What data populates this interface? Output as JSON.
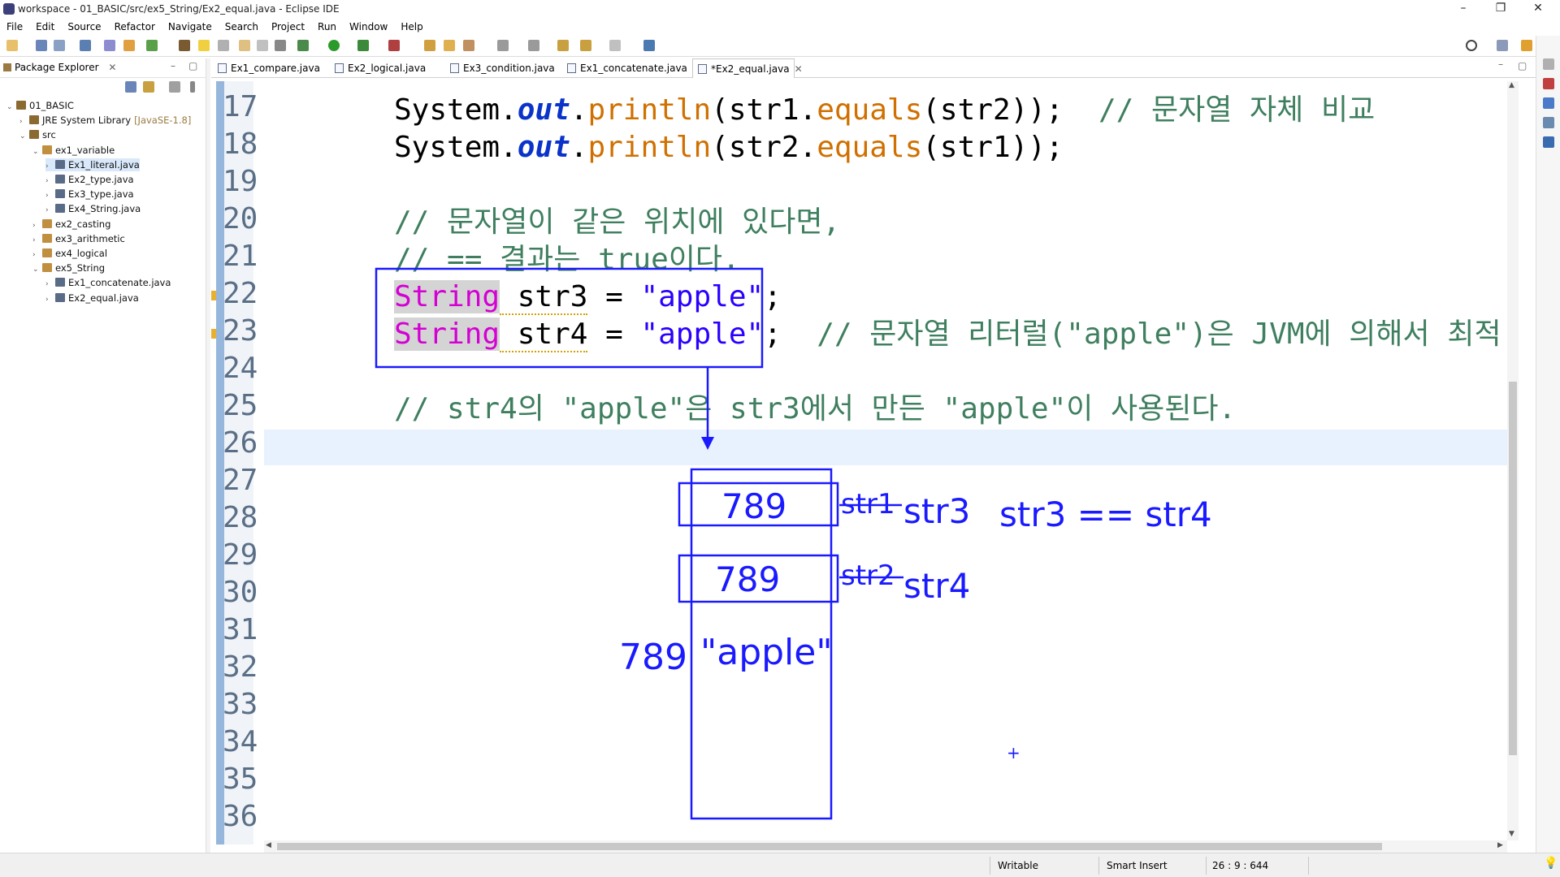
{
  "window": {
    "title": "workspace - 01_BASIC/src/ex5_String/Ex2_equal.java - Eclipse IDE"
  },
  "menu": [
    "File",
    "Edit",
    "Source",
    "Refactor",
    "Navigate",
    "Search",
    "Project",
    "Run",
    "Window",
    "Help"
  ],
  "package_explorer": {
    "tab_label": "Package Explorer",
    "tree": [
      {
        "label": "01_BASIC",
        "depth": 0,
        "expanded": true
      },
      {
        "label": "JRE System Library",
        "suffix": "[JavaSE-1.8]",
        "depth": 1,
        "expanded": false
      },
      {
        "label": "src",
        "depth": 1,
        "expanded": true
      },
      {
        "label": "ex1_variable",
        "depth": 2,
        "expanded": true
      },
      {
        "label": "Ex1_literal.java",
        "depth": 3,
        "selected": true
      },
      {
        "label": "Ex2_type.java",
        "depth": 3
      },
      {
        "label": "Ex3_type.java",
        "depth": 3
      },
      {
        "label": "Ex4_String.java",
        "depth": 3
      },
      {
        "label": "ex2_casting",
        "depth": 2
      },
      {
        "label": "ex3_arithmetic",
        "depth": 2
      },
      {
        "label": "ex4_logical",
        "depth": 2
      },
      {
        "label": "ex5_String",
        "depth": 2,
        "expanded": true
      },
      {
        "label": "Ex1_concatenate.java",
        "depth": 3
      },
      {
        "label": "Ex2_equal.java",
        "depth": 3
      }
    ]
  },
  "editor_tabs": [
    {
      "label": "Ex1_compare.java"
    },
    {
      "label": "Ex2_logical.java"
    },
    {
      "label": "Ex3_condition.java"
    },
    {
      "label": "Ex1_concatenate.java"
    },
    {
      "label": "*Ex2_equal.java",
      "active": true
    }
  ],
  "code": {
    "line_numbers": [
      "17",
      "18",
      "19",
      "20",
      "21",
      "22",
      "23",
      "24",
      "25",
      "26",
      "27",
      "28",
      "29",
      "30",
      "31",
      "32",
      "33",
      "34",
      "35",
      "36"
    ],
    "l17": {
      "a": "System.",
      "b": "out",
      "c": ".",
      "d": "println",
      "e": "(str1.",
      "f": "equals",
      "g": "(str2));  ",
      "h": "// 문자열 자체 비교"
    },
    "l18": {
      "a": "System.",
      "b": "out",
      "c": ".",
      "d": "println",
      "e": "(str2.",
      "f": "equals",
      "g": "(str1));"
    },
    "l20": "// 문자열이 같은 위치에 있다면,",
    "l21": "// == 결과는 true이다.",
    "l22": {
      "type": "String",
      "var": " str3",
      " eq": " = ",
      "val": "\"apple\"",
      "end": ";"
    },
    "l23": {
      "type": "String",
      "var": " str4",
      "eq": " = ",
      "val": "\"apple\"",
      "end": ";",
      "cmt": "  // 문자열 리터럴(\"apple\")은 JVM에 의해서 최적"
    },
    "l25": "// str4의 \"apple\"은 str3에서 만든 \"apple\"이 사용된다."
  },
  "annotations": {
    "box1_value": "789",
    "box2_value": "789",
    "strike1": "str1",
    "strike2": "str2",
    "label1": "str3",
    "label2": "str4",
    "compare": "str3 == str4",
    "addr": "789",
    "literal": "\"apple\"",
    "cross": "+"
  },
  "status": {
    "writable": "Writable",
    "insert": "Smart Insert",
    "position": "26 : 9 : 644"
  },
  "colors": {
    "ink": "#1a1aff",
    "keyword": "#d400d4",
    "string": "#2a00ff",
    "comment": "#3f7f5f",
    "method": "#d07000"
  }
}
